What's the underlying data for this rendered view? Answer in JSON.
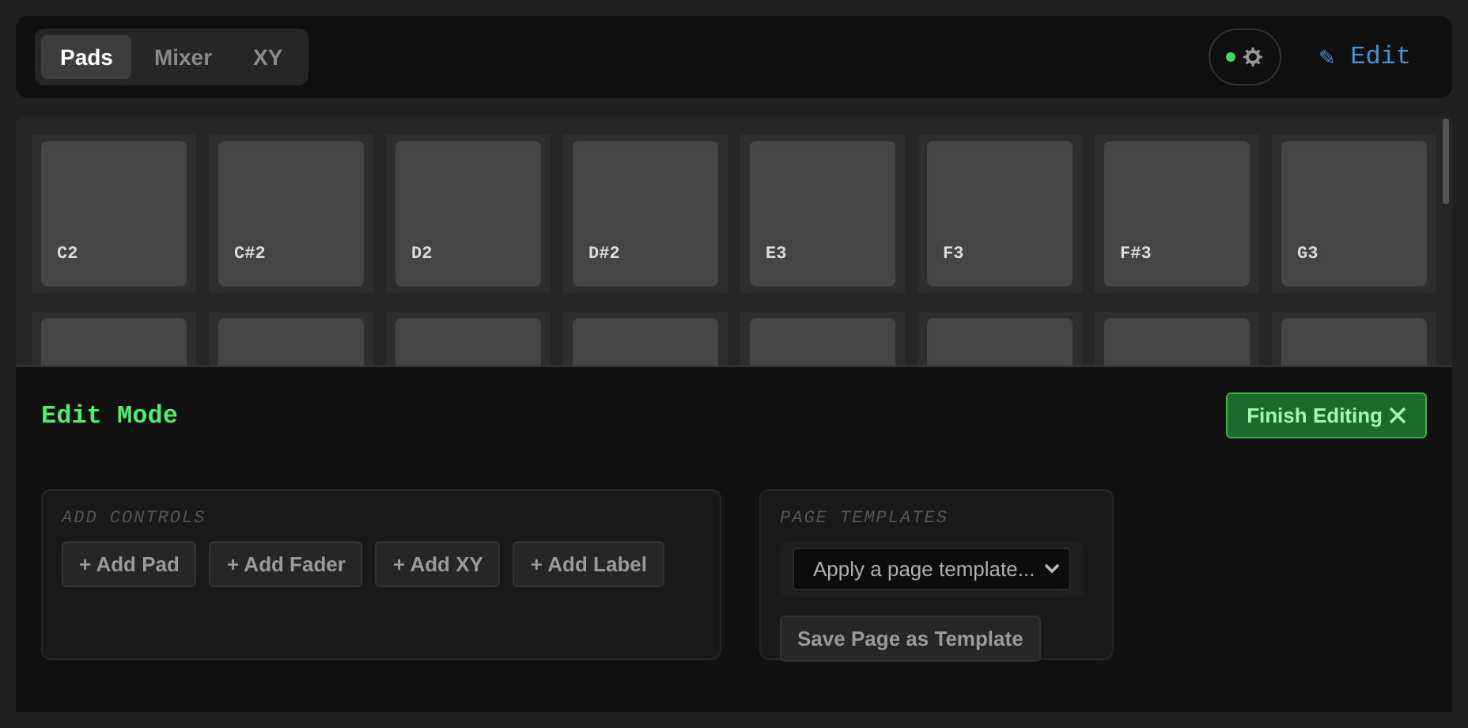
{
  "tabs": [
    {
      "label": "Pads",
      "selected": true
    },
    {
      "label": "Mixer",
      "selected": false
    },
    {
      "label": "XY",
      "selected": false
    }
  ],
  "status": {
    "connected": true
  },
  "edit_button": {
    "icon": "✎",
    "label": "Edit"
  },
  "pads": [
    {
      "kind": "pad",
      "label": "C2"
    },
    {
      "kind": "pad",
      "label": "C#2"
    },
    {
      "kind": "pad",
      "label": "D2"
    },
    {
      "kind": "pad",
      "label": "D#2"
    },
    {
      "kind": "pad",
      "label": "E3"
    },
    {
      "kind": "pad",
      "label": "F3"
    },
    {
      "kind": "pad",
      "label": "F#3"
    },
    {
      "kind": "pad",
      "label": "G3"
    },
    {
      "kind": "pad"
    },
    {
      "kind": "pad"
    },
    {
      "kind": "pad"
    },
    {
      "kind": "pad"
    },
    {
      "kind": "pad"
    },
    {
      "kind": "pad"
    },
    {
      "kind": "pad"
    },
    {
      "kind": "pad"
    }
  ],
  "edit_panel": {
    "title": "Edit Mode",
    "finish_button": "Finish Editing",
    "add_controls": {
      "title": "ADD CONTROLS",
      "buttons": [
        "+ Add Pad",
        "+ Add Fader",
        "+ Add XY",
        "+ Add Label"
      ]
    },
    "page_templates": {
      "title": "PAGE TEMPLATES",
      "select": "Apply a page template...",
      "save_button": "Save Page as Template"
    }
  }
}
